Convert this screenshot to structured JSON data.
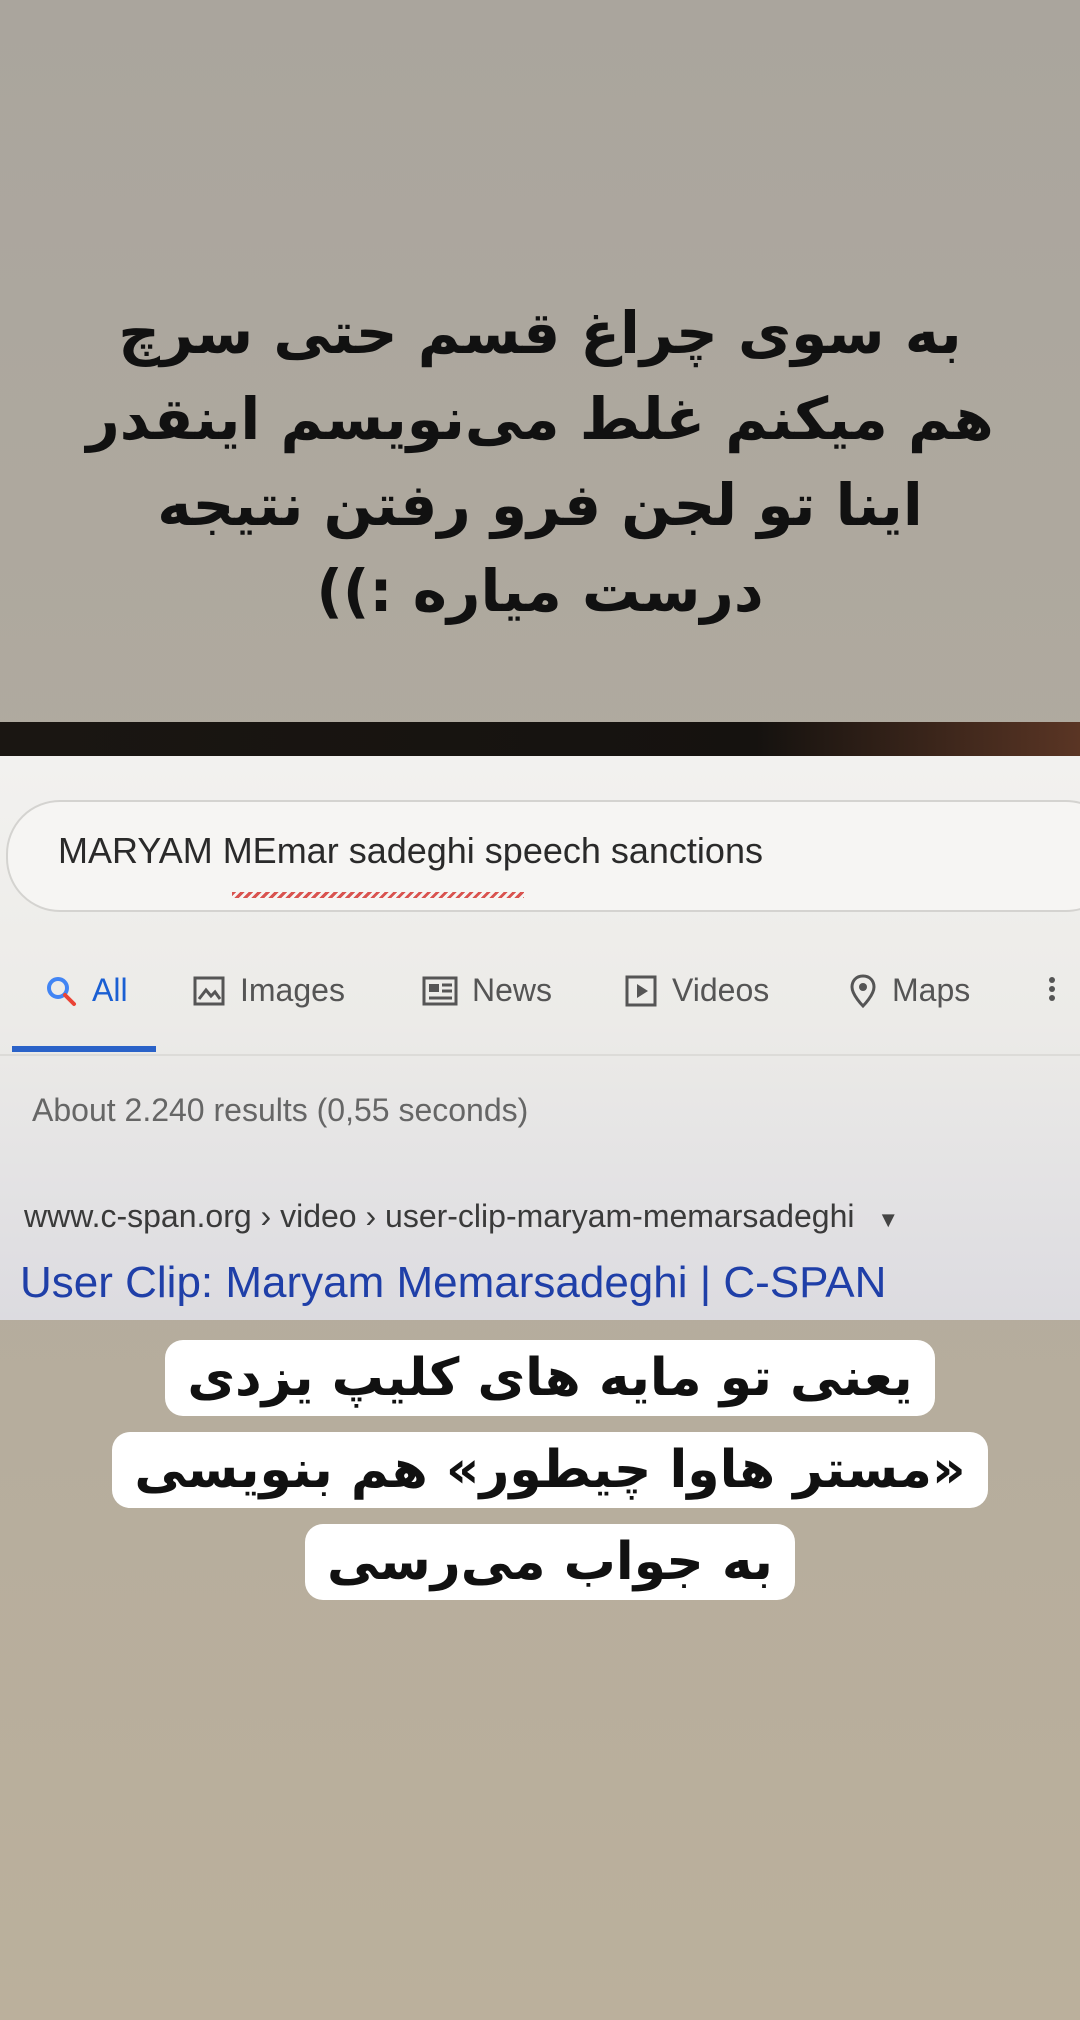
{
  "captions": {
    "top": "به سوی چراغ قسم حتی سرچ\nهم میکنم غلط می‌نویسم اینقدر\nاینا تو لجن فرو رفتن نتیجه\nدرست میاره :))",
    "bottom_lines": [
      "یعنی تو مایه های کلیپ یزدی",
      "«مستر هاوا چیطور» هم بنویسی",
      "به جواب می‌رسی"
    ]
  },
  "search": {
    "query": "MARYAM MEmar sadeghi speech sanctions"
  },
  "tabs": [
    {
      "label": "All",
      "icon": "search-icon",
      "active": true
    },
    {
      "label": "Images",
      "icon": "image-icon",
      "active": false
    },
    {
      "label": "News",
      "icon": "news-icon",
      "active": false
    },
    {
      "label": "Videos",
      "icon": "play-icon",
      "active": false
    },
    {
      "label": "Maps",
      "icon": "map-pin-icon",
      "active": false
    }
  ],
  "results": {
    "stats": "About 2.240 results (0,55 seconds)",
    "first": {
      "url": "www.c-span.org › video › user-clip-maryam-memarsadeghi",
      "title": "User Clip: Maryam Memarsadeghi | C-SPAN"
    }
  },
  "colors": {
    "accent": "#1a5fd3",
    "link": "#1f3fa8",
    "spell_error": "#d9534f"
  }
}
